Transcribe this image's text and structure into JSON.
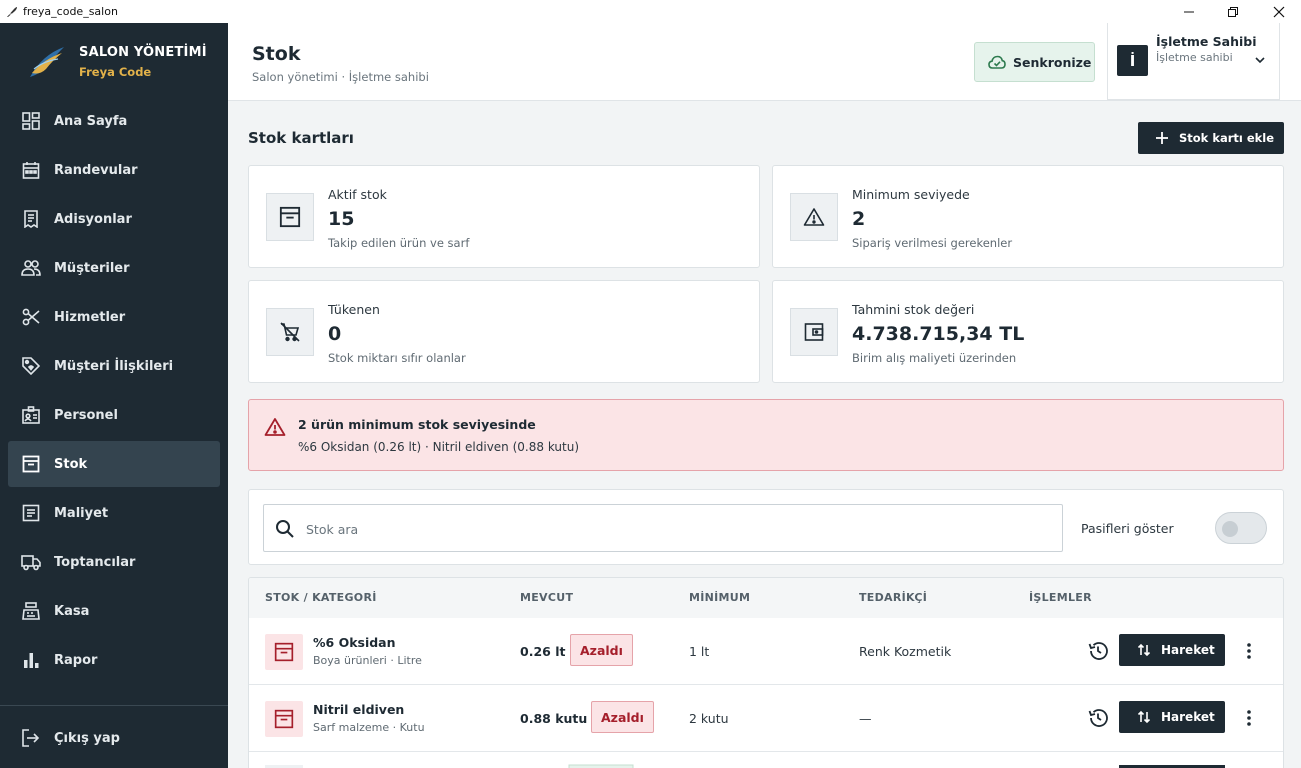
{
  "window": {
    "title": "freya_code_salon"
  },
  "brand": {
    "name": "SALON YÖNETİMİ",
    "subtitle": "Freya Code"
  },
  "sidebar": {
    "items": [
      {
        "label": "Ana Sayfa",
        "icon": "dashboard-icon"
      },
      {
        "label": "Randevular",
        "icon": "calendar-icon"
      },
      {
        "label": "Adisyonlar",
        "icon": "receipt-icon"
      },
      {
        "label": "Müşteriler",
        "icon": "people-icon"
      },
      {
        "label": "Hizmetler",
        "icon": "scissors-icon"
      },
      {
        "label": "Müşteri İlişkileri",
        "icon": "tag-icon"
      },
      {
        "label": "Personel",
        "icon": "badge-icon"
      },
      {
        "label": "Stok",
        "icon": "archive-icon",
        "active": true
      },
      {
        "label": "Maliyet",
        "icon": "invoice-icon"
      },
      {
        "label": "Toptancılar",
        "icon": "truck-icon"
      },
      {
        "label": "Kasa",
        "icon": "cash-register-icon"
      },
      {
        "label": "Rapor",
        "icon": "bar-chart-icon"
      }
    ],
    "logout_label": "Çıkış yap"
  },
  "header": {
    "title": "Stok",
    "subtitle": "Salon yönetimi · İşletme sahibi",
    "sync_label": "Senkronize",
    "user_initial": "İ",
    "user_name": "İşletme Sahibi",
    "user_role": "İşletme sahibi"
  },
  "section": {
    "title": "Stok kartları",
    "add_label": "Stok kartı ekle"
  },
  "stats": [
    {
      "label": "Aktif stok",
      "value": "15",
      "desc": "Takip edilen ürün ve sarf",
      "icon": "archive-icon"
    },
    {
      "label": "Minimum seviyede",
      "value": "2",
      "desc": "Sipariş verilmesi gerekenler",
      "icon": "warning-icon"
    },
    {
      "label": "Tükenen",
      "value": "0",
      "desc": "Stok miktarı sıfır olanlar",
      "icon": "cart-off-icon"
    },
    {
      "label": "Tahmini stok değeri",
      "value": "4.738.715,34 TL",
      "desc": "Birim alış maliyeti üzerinden",
      "icon": "wallet-icon"
    }
  ],
  "alert": {
    "title": "2 ürün minimum stok seviyesinde",
    "text": "%6 Oksidan (0.26 lt) · Nitril eldiven (0.88 kutu)",
    "color": "#a51f2b"
  },
  "search": {
    "placeholder": "Stok ara",
    "value": "",
    "toggle_label": "Pasifleri göster",
    "toggle_on": false
  },
  "table": {
    "headers": [
      "STOK / KATEGORİ",
      "MEVCUT",
      "MİNİMUM",
      "TEDARİKÇİ",
      "İŞLEMLER"
    ],
    "rows": [
      {
        "name": "%6 Oksidan",
        "category": "Boya ürünleri · Litre",
        "qty": "0.26 lt",
        "status": "Azaldı",
        "minimum": "1 lt",
        "supplier": "Renk Kozmetik",
        "action": "Hareket"
      },
      {
        "name": "Nitril eldiven",
        "category": "Sarf malzeme · Kutu",
        "qty": "0.88 kutu",
        "status": "Azaldı",
        "minimum": "2 kutu",
        "supplier": "—",
        "action": "Hareket"
      }
    ]
  },
  "colors": {
    "sidebar": "#1e2a33",
    "accent": "#1e2a33",
    "brand_gold": "#e3b24a",
    "danger": "#a51f2b",
    "sync_bg": "#e6f3ec"
  }
}
